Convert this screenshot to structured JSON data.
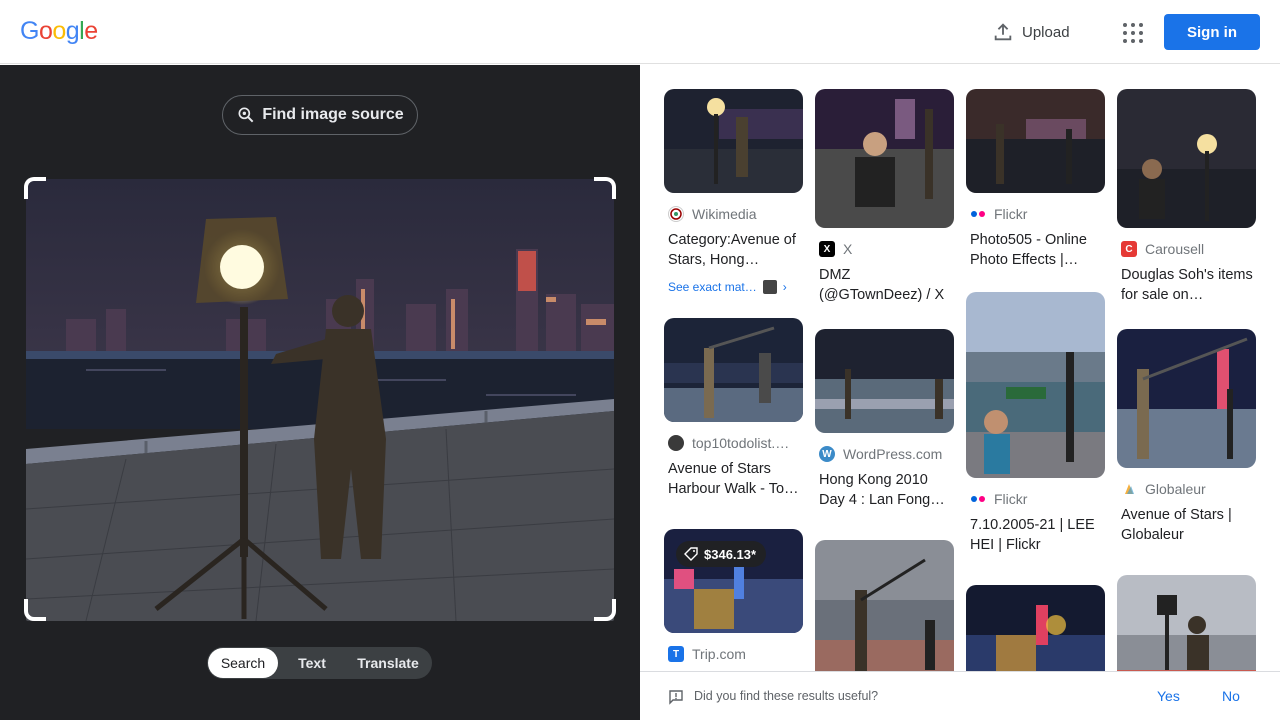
{
  "header": {
    "logo_letters": [
      {
        "ch": "G",
        "color": "#4285f4"
      },
      {
        "ch": "o",
        "color": "#ea4335"
      },
      {
        "ch": "o",
        "color": "#fbbc05"
      },
      {
        "ch": "g",
        "color": "#4285f4"
      },
      {
        "ch": "l",
        "color": "#34a853"
      },
      {
        "ch": "e",
        "color": "#ea4335"
      }
    ],
    "upload_label": "Upload",
    "apps_icon": "apps-grid-icon",
    "signin_label": "Sign in"
  },
  "left": {
    "find_source_label": "Find image source",
    "tabs": [
      "Search",
      "Text",
      "Translate"
    ],
    "active_tab": "Search"
  },
  "results": [
    {
      "source": "Wikimedia",
      "title": "Category:Avenue of Stars, Hong…",
      "exact_match": "See exact mat…",
      "favicon_color": "#ffffff",
      "favicon_icon": "wikimedia-icon"
    },
    {
      "source": "X",
      "title": "DMZ (@GTownDeez) / X",
      "favicon_color": "#000000",
      "favicon_icon": "x-icon"
    },
    {
      "source": "Flickr",
      "title": "Photo505 - Online Photo Effects |…",
      "favicon_color": "#ffffff",
      "favicon_icon": "flickr-icon"
    },
    {
      "source": "Carousell",
      "title": "Douglas Soh's items for sale on…",
      "favicon_color": "#e53935",
      "favicon_icon": "carousell-icon"
    },
    {
      "source": "top10todolist.…",
      "title": "Avenue of Stars Harbour Walk - To…",
      "favicon_color": "#3a3a3a",
      "favicon_icon": "top10-icon"
    },
    {
      "source": "WordPress.com",
      "title": "Hong Kong 2010 Day 4 : Lan Fong…",
      "favicon_color": "#3c8bc8",
      "favicon_icon": "wordpress-icon"
    },
    {
      "source": "Flickr",
      "title": "7.10.2005-21 | LEE HEI | Flickr",
      "favicon_color": "#ffffff",
      "favicon_icon": "flickr-icon"
    },
    {
      "source": "Globaleur",
      "title": "Avenue of Stars | Globaleur",
      "favicon_color": "#ffffff",
      "favicon_icon": "globaleur-icon"
    },
    {
      "source": "Trip.com",
      "title": "",
      "price": "$346.13*",
      "favicon_color": "#1a73e8",
      "favicon_icon": "trip-icon"
    }
  ],
  "feedback": {
    "question": "Did you find these results useful?",
    "yes": "Yes",
    "no": "No"
  }
}
